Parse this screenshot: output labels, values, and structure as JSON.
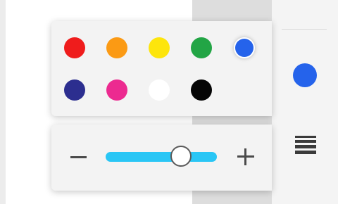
{
  "colors": {
    "canvas_bg": "#ffffff",
    "current_stroke": "#2563eb",
    "slider_track": "#29c6f5"
  },
  "palette": {
    "swatches": [
      {
        "name": "red",
        "hex": "#ef1c1c",
        "selected": false
      },
      {
        "name": "orange",
        "hex": "#fb9a14",
        "selected": false
      },
      {
        "name": "yellow",
        "hex": "#fde50c",
        "selected": false
      },
      {
        "name": "green",
        "hex": "#22a545",
        "selected": false
      },
      {
        "name": "blue",
        "hex": "#2563eb",
        "selected": true
      },
      {
        "name": "navy",
        "hex": "#2c2e8f",
        "selected": false
      },
      {
        "name": "pink",
        "hex": "#ec2a90",
        "selected": false
      },
      {
        "name": "white",
        "hex": "#ffffff",
        "selected": false
      },
      {
        "name": "black",
        "hex": "#050505",
        "selected": false
      }
    ]
  },
  "stroke_size": {
    "decrease_icon": "minus-icon",
    "increase_icon": "plus-icon",
    "value_fraction": 0.68
  },
  "toolbar": {
    "current_color_icon": "color-dot-icon",
    "thickness_icon": "line-thickness-icon"
  }
}
